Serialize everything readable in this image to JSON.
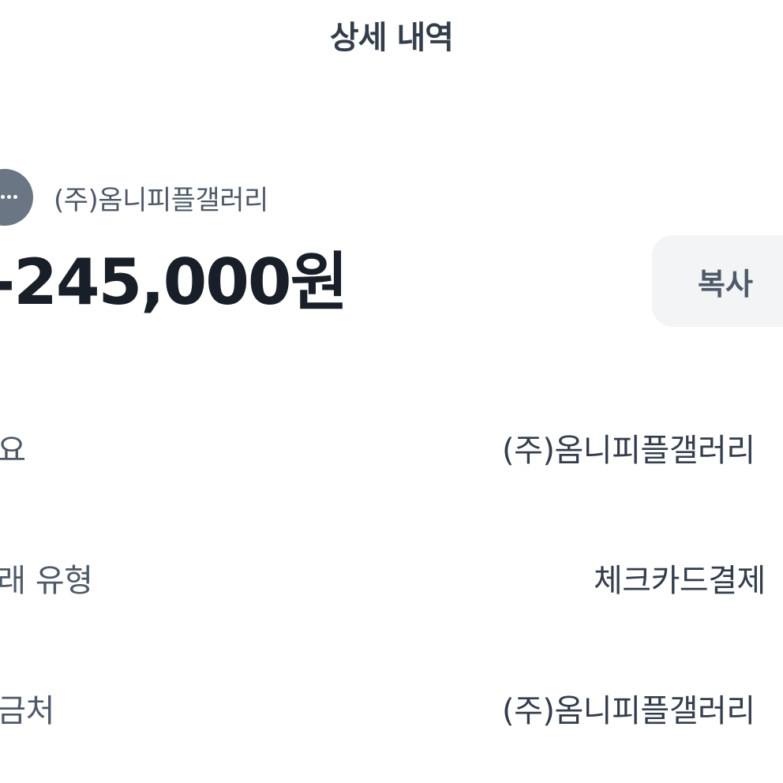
{
  "header": {
    "title": "상세 내역"
  },
  "transaction": {
    "merchant_icon": "more-dots-icon",
    "merchant_name": "(주)옴니피플갤러리",
    "amount": "-245,000원",
    "copy_label": "복사"
  },
  "details": [
    {
      "label": "적요",
      "value": "(주)옴니피플갤러리"
    },
    {
      "label": "거래 유형",
      "value": "체크카드결제"
    },
    {
      "label": "입금처",
      "value": "(주)옴니피플갤러리"
    }
  ],
  "colors": {
    "background": "#ffffff",
    "primary_text": "#191f28",
    "secondary_text": "#4e5968",
    "button_bg": "#f2f4f6",
    "avatar_bg": "#6b7684"
  }
}
